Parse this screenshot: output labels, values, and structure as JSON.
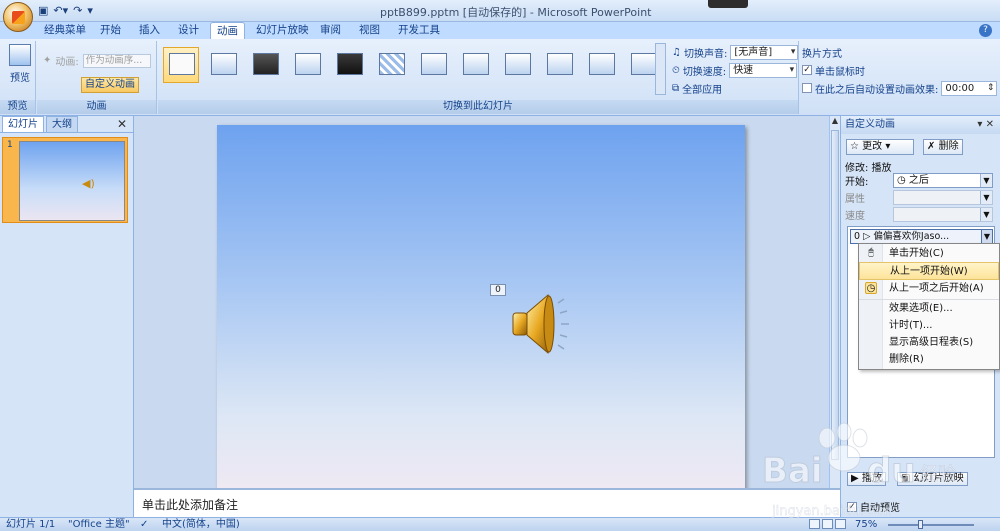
{
  "window": {
    "title": "pptB899.pptm [自动保存的] - Microsoft PowerPoint",
    "qat_icons": [
      "save-icon",
      "undo-icon",
      "redo-icon",
      "customize-icon"
    ]
  },
  "tabs": [
    "经典菜单",
    "开始",
    "插入",
    "设计",
    "动画",
    "幻灯片放映",
    "审阅",
    "视图",
    "开发工具"
  ],
  "active_tab": "动画",
  "ribbon": {
    "preview_group": {
      "button": "预览",
      "label": "预览"
    },
    "animation_group": {
      "animate_label": "动画:",
      "animate_value": "作为动画序...",
      "custom_button": "自定义动画",
      "label": "动画"
    },
    "transition_group": {
      "sound_label": "切换声音:",
      "sound_value": "[无声音]",
      "speed_label": "切换速度:",
      "speed_value": "快速",
      "apply_all": "全部应用",
      "label": "切换到此幻灯片"
    },
    "advance_group": {
      "title": "换片方式",
      "on_click": "单击鼠标时",
      "on_click_checked": true,
      "auto_after": "在此之后自动设置动画效果:",
      "auto_after_checked": false,
      "auto_time": "00:00"
    }
  },
  "slides_pane": {
    "tabs": [
      "幻灯片",
      "大纲"
    ],
    "active": "幻灯片",
    "slide_number": "1"
  },
  "slide": {
    "anim_tag": "0"
  },
  "notes": {
    "placeholder": "单击此处添加备注"
  },
  "task_pane": {
    "title": "自定义动画",
    "change_button": "更改",
    "delete_button": "删除",
    "modify_label": "修改: 播放",
    "start_label": "开始:",
    "start_value": "之后",
    "property_label": "属性",
    "speed_label": "速度",
    "list_item": "0  ▷ 偏偏喜欢你Jaso...",
    "context_menu": [
      "单击开始(C)",
      "从上一项开始(W)",
      "从上一项之后开始(A)",
      "效果选项(E)...",
      "计时(T)...",
      "显示高级日程表(S)",
      "删除(R)"
    ],
    "play_button": "播放",
    "slideshow_button": "幻灯片放映",
    "autopreview": "自动预览"
  },
  "status": {
    "slide_count": "幻灯片 1/1",
    "theme": "\"Office 主题\"",
    "language": "中文(简体，中国)",
    "zoom": "75%"
  }
}
